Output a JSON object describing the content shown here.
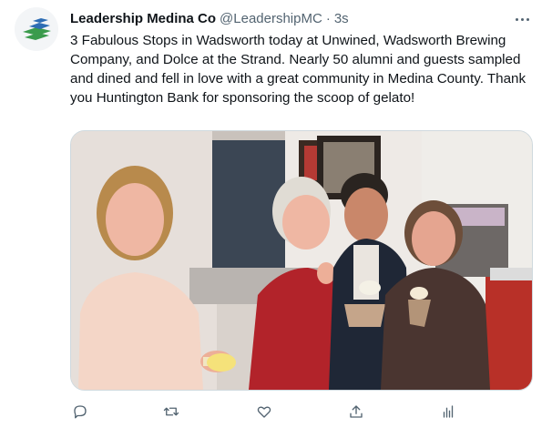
{
  "tweet": {
    "author_name": "Leadership Medina Co",
    "author_handle": "@LeadershipMC",
    "separator": "·",
    "timestamp": "3s",
    "text": "3 Fabulous Stops in Wadsworth today at Unwined, Wadsworth Brewing Company, and Dolce at the Strand. Nearly 50 alumni and guests sampled and dined and fell in love with a great community in Medina County. Thank you Huntington Bank for sponsoring the scoop of gelato!",
    "media": {
      "description_icon": "photo-icon"
    },
    "actions": {
      "icons": [
        "reply-icon",
        "retweet-icon",
        "like-icon",
        "share-icon",
        "analytics-icon"
      ]
    }
  },
  "colors": {
    "text": "#0f1419",
    "secondary": "#536471",
    "border": "#cfd9de",
    "logo_blue": "#2e6db4",
    "logo_green": "#3a9b4c"
  }
}
